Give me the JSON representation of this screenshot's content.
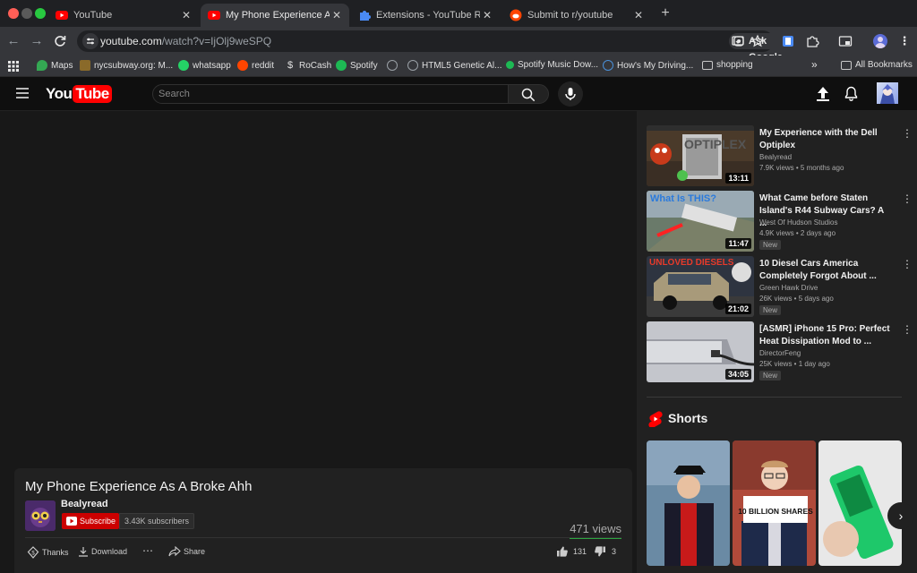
{
  "browser": {
    "tabs": [
      {
        "title": "YouTube",
        "active": false
      },
      {
        "title": "My Phone Experience As A Br",
        "active": true
      },
      {
        "title": "Extensions - YouTube Redux",
        "active": false
      },
      {
        "title": "Submit to r/youtube",
        "active": false
      }
    ],
    "url_host": "youtube.com",
    "url_path": "/watch?v=IjOlj9weSPQ",
    "ask_google": "Ask Google",
    "bookmarks": [
      {
        "label": "Maps",
        "color": "#34a853"
      },
      {
        "label": "nycsubway.org: M...",
        "color": "#8a6a2a"
      },
      {
        "label": "whatsapp",
        "color": "#25d366"
      },
      {
        "label": "reddit",
        "color": "#ff4500"
      },
      {
        "label": "RoCash",
        "color": "#4caf50"
      },
      {
        "label": "Spotify",
        "color": "#1db954"
      },
      {
        "label": "",
        "color": "#9aa0a6"
      },
      {
        "label": "HTML5 Genetic Al...",
        "color": "#9aa0a6"
      },
      {
        "label": "Spotify Music Dow...",
        "color": "#1db954"
      },
      {
        "label": "How's My Driving...",
        "color": "#4a90d9"
      },
      {
        "label": "shopping",
        "color": "#9aa0a6"
      }
    ],
    "all_bookmarks": "All Bookmarks"
  },
  "youtube": {
    "logo": "YouTube",
    "search_placeholder": "Search"
  },
  "video": {
    "title": "My Phone Experience As A Broke Ahh",
    "channel": "Bealyread",
    "subscribe_label": "Subscribe",
    "subscribers": "3.43K subscribers",
    "views": "471 views",
    "actions": {
      "thanks": "Thanks",
      "download": "Download",
      "more": "⋯",
      "share": "Share",
      "likes": "131",
      "dislikes": "3"
    }
  },
  "recommendations": [
    {
      "title": "My Experience with the Dell Optiplex",
      "channel": "Bealyread",
      "meta": "7.9K views • 5 months ago",
      "duration": "13:11",
      "badge": ""
    },
    {
      "title": "What Came before Staten Island's R44 Subway Cars?  A ...",
      "channel": "West Of Hudson Studios",
      "meta": "4.9K views • 2 days ago",
      "duration": "11:47",
      "badge": "New"
    },
    {
      "title": "10 Diesel Cars America Completely Forgot About ...",
      "channel": "Green Hawk Drive",
      "meta": "26K views • 5 days ago",
      "duration": "21:02",
      "badge": "New"
    },
    {
      "title": "[ASMR] iPhone 15 Pro: Perfect Heat Dissipation Mod to ...",
      "channel": "DirectorFeng",
      "meta": "25K views • 1 day ago",
      "duration": "34:05",
      "badge": "New"
    }
  ],
  "thumb_text": {
    "optiplex": "OPTIPLEX",
    "what_is_this": "What Is THIS?",
    "unloved": "UNLOVED DIESELS"
  },
  "shorts": {
    "heading": "Shorts",
    "items": [
      {
        "caption": ""
      },
      {
        "caption": "10 BILLION SHARES"
      },
      {
        "caption": ""
      }
    ]
  },
  "colors": {
    "brand_red": "#ff0000",
    "subscribe_red": "#cc0000",
    "views_bar": "#2ba640"
  }
}
